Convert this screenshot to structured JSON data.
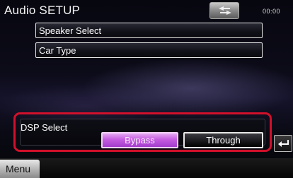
{
  "header": {
    "title": "Audio SETUP",
    "back_icon": "back-arrow-icon",
    "clock": "00:00"
  },
  "menu": {
    "items": [
      {
        "label": "Speaker Select"
      },
      {
        "label": "Car Type"
      }
    ]
  },
  "dsp": {
    "label": "DSP Select",
    "options": [
      {
        "label": "Bypass",
        "selected": true
      },
      {
        "label": "Through",
        "selected": false
      }
    ],
    "highlight_color": "#d2102b",
    "selected_color": "#c55ce0"
  },
  "footer": {
    "menu_label": "Menu",
    "return_icon": "return-arrow-icon"
  }
}
